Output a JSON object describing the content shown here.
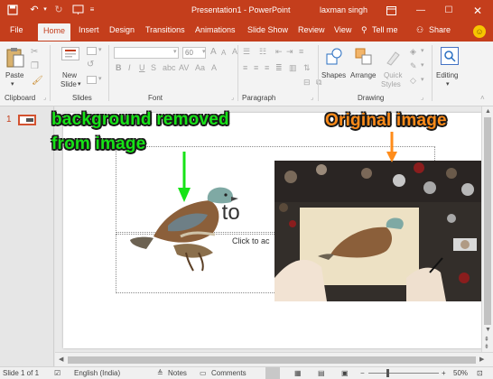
{
  "titlebar": {
    "title": "Presentation1  -  PowerPoint",
    "user": "laxman singh"
  },
  "tabs": [
    "File",
    "Home",
    "Insert",
    "Design",
    "Transitions",
    "Animations",
    "Slide Show",
    "Review",
    "View"
  ],
  "tell_me": "Tell me",
  "share": "Share",
  "ribbon": {
    "paste": "Paste",
    "new_slide_line1": "New",
    "new_slide_line2": "Slide",
    "font_size": "60",
    "shapes": "Shapes",
    "arrange": "Arrange",
    "quick_line1": "Quick",
    "quick_line2": "Styles",
    "editing": "Editing",
    "groups": {
      "clipboard": "Clipboard",
      "slides": "Slides",
      "font": "Font",
      "paragraph": "Paragraph",
      "drawing": "Drawing"
    }
  },
  "thumbnail": {
    "number": "1"
  },
  "slide": {
    "title_partial": "k to",
    "subtitle_partial": "Click to ac"
  },
  "annotations": {
    "removed_line1": "background removed",
    "removed_line2": "from image",
    "original": "Original image",
    "green": "#17e317",
    "orange": "#ff8c1a"
  },
  "status": {
    "slide": "Slide 1 of 1",
    "language": "English (India)",
    "notes": "Notes",
    "comments": "Comments",
    "zoom": "50%"
  },
  "colors": {
    "accent": "#c43e1c"
  }
}
